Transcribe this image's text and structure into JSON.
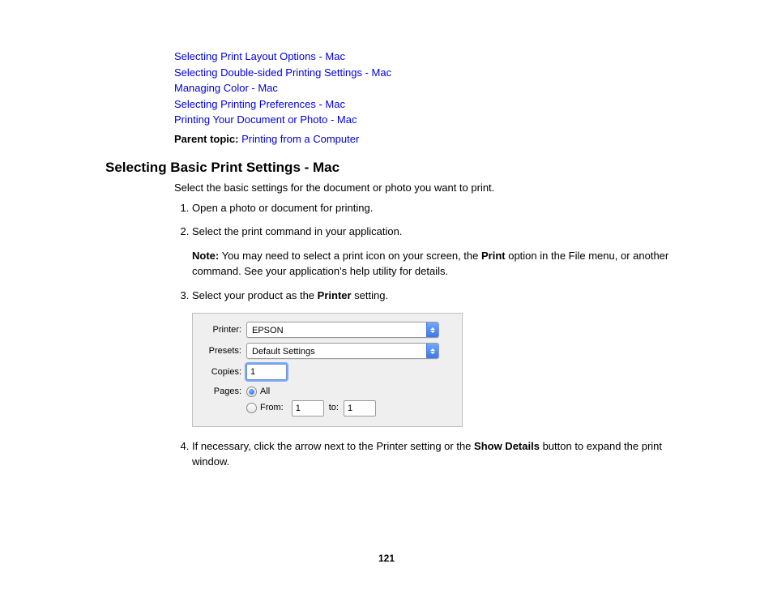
{
  "links": [
    "Selecting Print Layout Options - Mac",
    "Selecting Double-sided Printing Settings - Mac",
    "Managing Color - Mac",
    "Selecting Printing Preferences - Mac",
    "Printing Your Document or Photo - Mac"
  ],
  "parent_topic": {
    "label": "Parent topic:",
    "link": "Printing from a Computer"
  },
  "heading": "Selecting Basic Print Settings - Mac",
  "intro": "Select the basic settings for the document or photo you want to print.",
  "steps": {
    "s1": "Open a photo or document for printing.",
    "s2": "Select the print command in your application.",
    "note_label": "Note:",
    "note_body_1": " You may need to select a print icon on your screen, the ",
    "note_bold_1": "Print",
    "note_body_2": " option in the File menu, or another command. See your application's help utility for details.",
    "s3_a": "Select your product as the ",
    "s3_bold": "Printer",
    "s3_b": " setting.",
    "s4_a": "If necessary, click the arrow next to the Printer setting or the ",
    "s4_bold": "Show Details",
    "s4_b": " button to expand the print window."
  },
  "dialog": {
    "printer_label": "Printer:",
    "printer_value": "EPSON",
    "presets_label": "Presets:",
    "presets_value": "Default Settings",
    "copies_label": "Copies:",
    "copies_value": "1",
    "pages_label": "Pages:",
    "all_label": "All",
    "from_label": "From:",
    "from_value": "1",
    "to_label": "to:",
    "to_value": "1"
  },
  "page_number": "121"
}
